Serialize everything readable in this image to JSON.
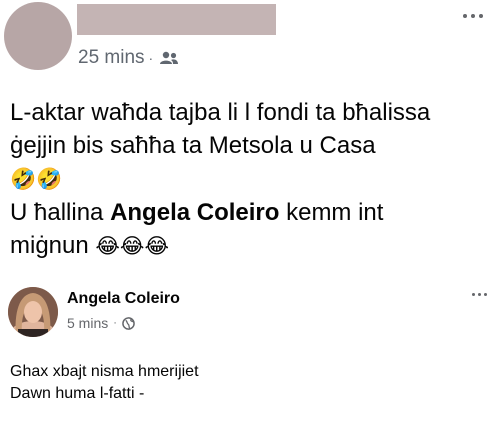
{
  "post": {
    "author_name": "",
    "time": "25 mins",
    "separator": "·",
    "audience_icon": "friends-icon",
    "more_icon": "more-horizontal-icon",
    "lines": {
      "l1": "L-aktar waħda tajba li l fondi ta bħalissa",
      "l2": "ġejjin bis saħħa ta Metsola u Casa",
      "l3_emoji": "🤣🤣",
      "l4_prefix": "U ħallina ",
      "l4_bold": "Angela Coleiro",
      "l4_suffix": " kemm int",
      "l5_word": "miġnun ",
      "l5_emoji": "😂😂😂"
    }
  },
  "comment": {
    "author": "Angela Coleiro",
    "time": "5 mins",
    "separator": "·",
    "audience_icon": "globe-icon",
    "more_icon": "more-horizontal-icon",
    "text_lines": [
      "Ghax xbajt nisma hmerijiet",
      "Dawn huma l-fatti -"
    ]
  }
}
